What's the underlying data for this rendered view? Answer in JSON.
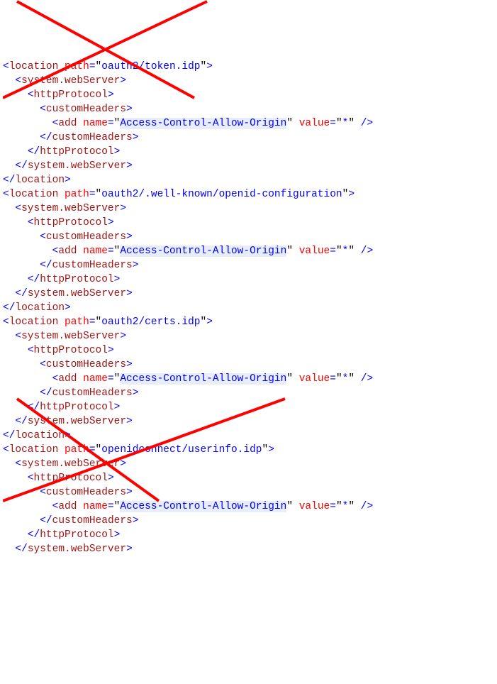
{
  "loc1": {
    "open": "location",
    "pathAttr": "path",
    "pathVal": "oauth2/token.idp",
    "sws": "system.webServer",
    "hp": "httpProtocol",
    "ch": "customHeaders",
    "add": "add",
    "nameAttr": "name",
    "nameVal": "Access-Control-Allow-Origin",
    "valueAttr": "value",
    "valueVal": "*"
  },
  "loc2": {
    "open": "location",
    "pathAttr": "path",
    "pathVal": "oauth2/.well-known/openid-configuration",
    "sws": "system.webServer",
    "hp": "httpProtocol",
    "ch": "customHeaders",
    "add": "add",
    "nameAttr": "name",
    "nameVal": "Access-Control-Allow-Origin",
    "valueAttr": "value",
    "valueVal": "*"
  },
  "loc3": {
    "open": "location",
    "pathAttr": "path",
    "pathVal": "oauth2/certs.idp",
    "sws": "system.webServer",
    "hp": "httpProtocol",
    "ch": "customHeaders",
    "add": "add",
    "nameAttr": "name",
    "nameVal": "Access-Control-Allow-Origin",
    "valueAttr": "value",
    "valueVal": "*"
  },
  "loc4": {
    "open": "location",
    "pathAttr": "path",
    "pathVal": "openidconnect/userinfo.idp",
    "sws": "system.webServer",
    "hp": "httpProtocol",
    "ch": "customHeaders",
    "add": "add",
    "nameAttr": "name",
    "nameVal": "Access-Control-Allow-Origin",
    "valueAttr": "value",
    "valueVal": "*"
  }
}
